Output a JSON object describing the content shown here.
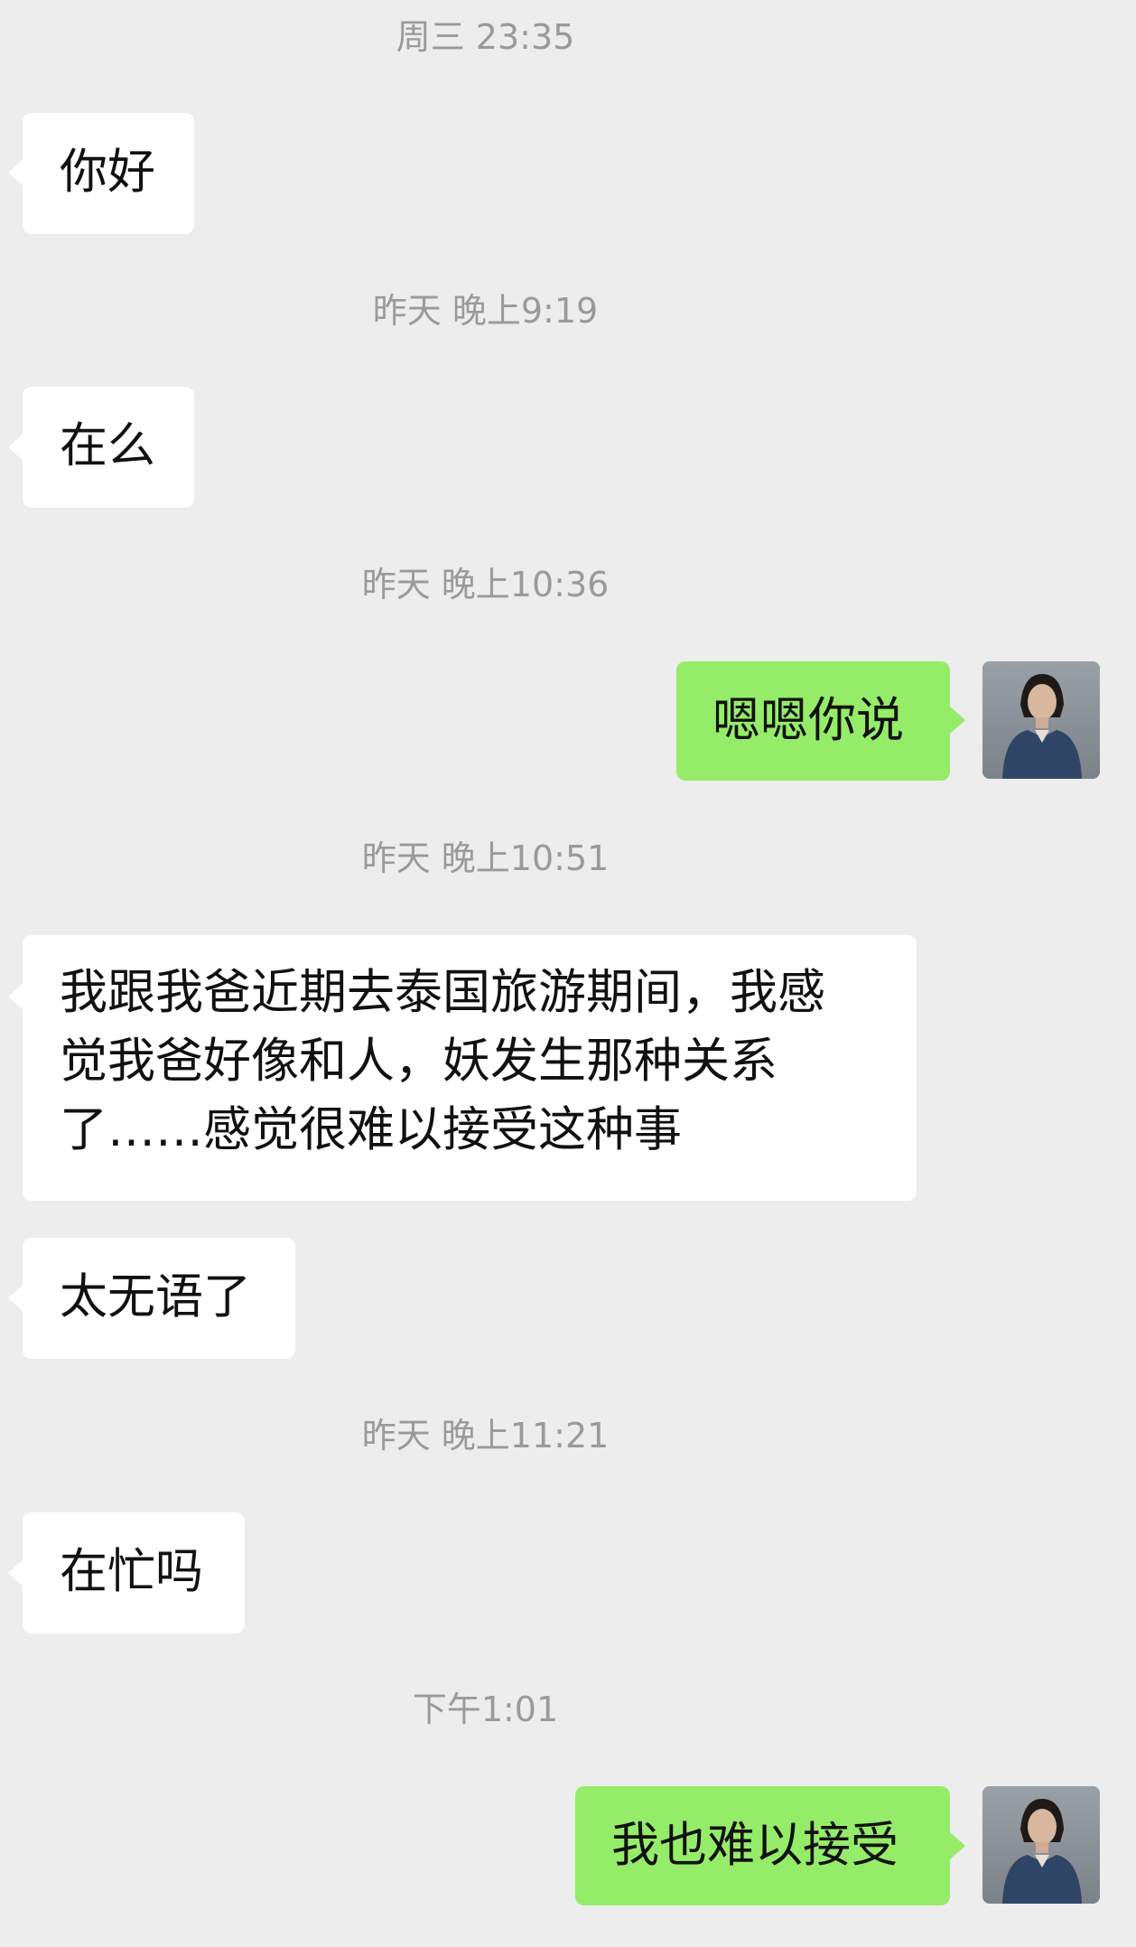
{
  "timestamps": [
    "周三 23:35",
    "昨天 晚上9:19",
    "昨天 晚上10:36",
    "昨天 晚上10:51",
    "昨天 晚上11:21",
    "下午1:01"
  ],
  "messages": {
    "m1": "你好",
    "m2": "在么",
    "m3": "嗯嗯你说",
    "m4_lines": [
      "我跟我爸近期去泰国旅游期间，我感",
      "觉我爸好像和人，妖发生那种关系",
      "了……感觉很难以接受这种事"
    ],
    "m5": "太无语了",
    "m6": "在忙吗",
    "m7": "我也难以接受"
  },
  "colors": {
    "background": "#ededed",
    "incoming_bubble": "#ffffff",
    "outgoing_bubble": "#95ec69",
    "timestamp_text": "#9a9a9a"
  },
  "icons": {
    "avatar": "user-avatar-photo"
  }
}
